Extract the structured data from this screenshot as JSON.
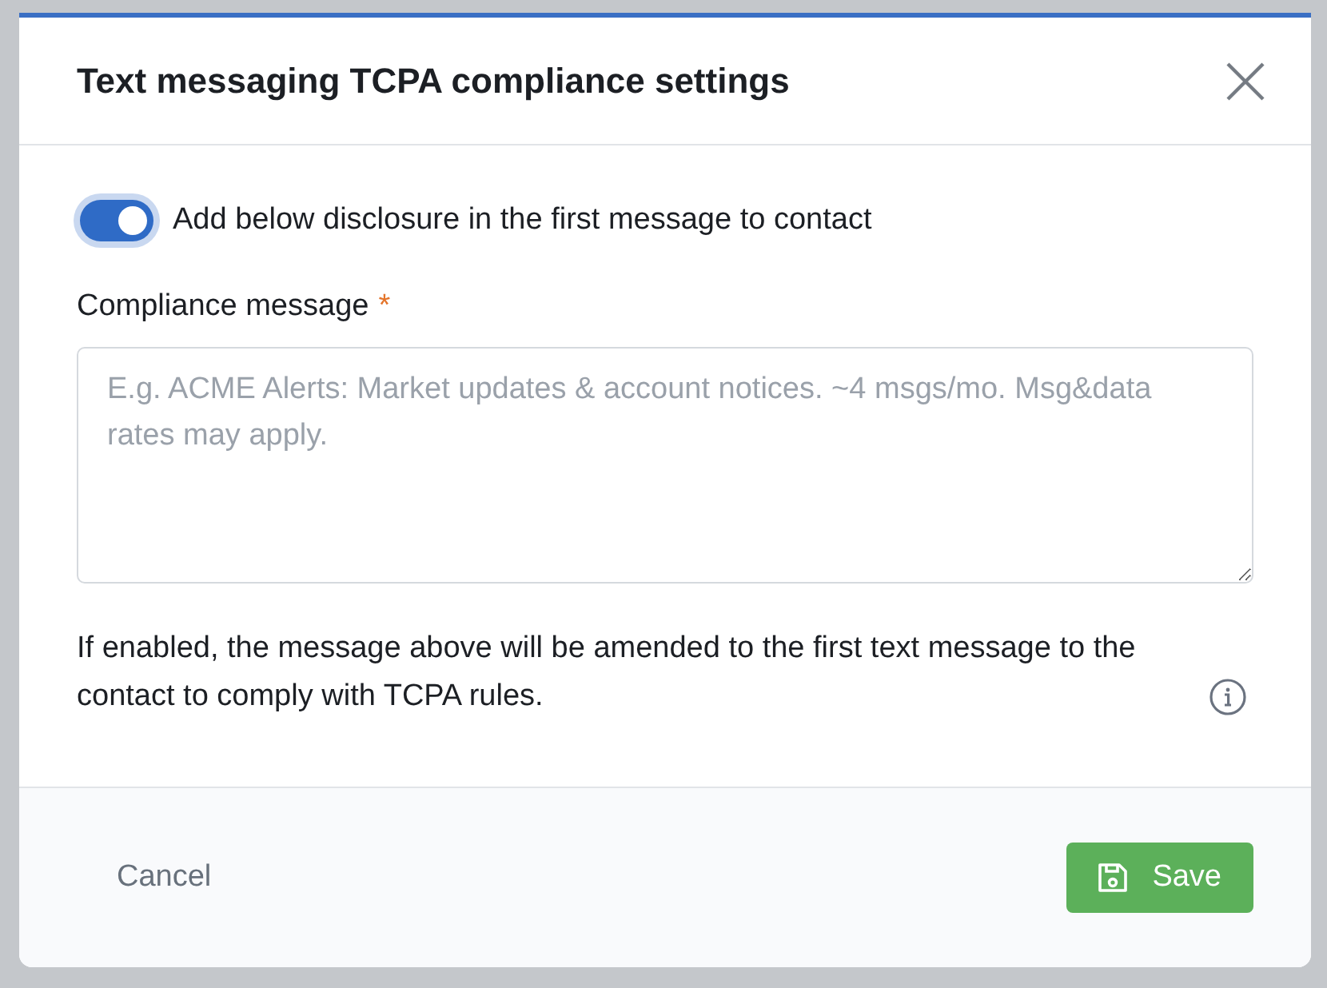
{
  "dialog": {
    "title": "Text messaging TCPA compliance settings"
  },
  "toggle": {
    "label": "Add below disclosure in the first message to contact",
    "on": true
  },
  "field": {
    "label": "Compliance message",
    "required_mark": "*",
    "placeholder": "E.g. ACME Alerts: Market updates & account notices. ~4 msgs/mo. Msg&data rates may apply."
  },
  "note": "If enabled, the message above will be amended to the first text message to the contact to comply with TCPA rules.",
  "buttons": [
    {
      "kind": "cancel",
      "label": "Cancel"
    },
    {
      "kind": "save",
      "label": "Save"
    }
  ]
}
